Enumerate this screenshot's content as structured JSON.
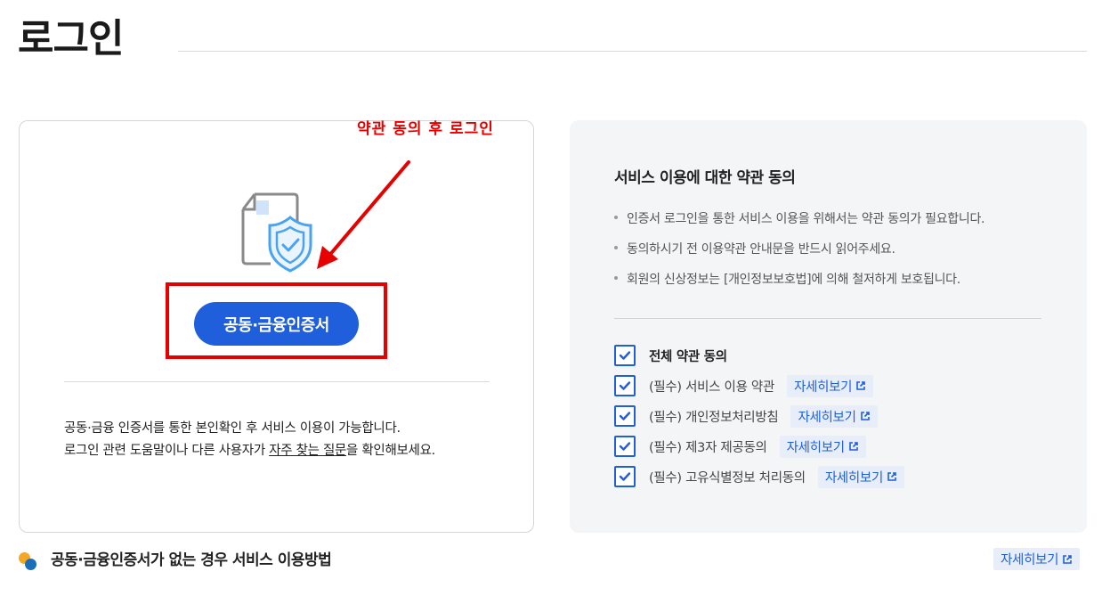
{
  "page": {
    "title": "로그인"
  },
  "annotation": {
    "text": "약관 동의 후 로그인",
    "color": "#e60000"
  },
  "login": {
    "cert_button_label": "공동·금융인증서",
    "help_line_1": "공동·금융 인증서를 통한 본인확인 후 서비스 이용이 가능합니다.",
    "help_line_2_prefix": "로그인 관련 도움말이나 다른 사용자가 ",
    "help_line_2_link": "자주 찾는 질문",
    "help_line_2_suffix": "을 확인해보세요."
  },
  "terms": {
    "heading": "서비스 이용에 대한 약관 동의",
    "notices": [
      "인증서 로그인을 통한 서비스 이용을 위해서는 약관 동의가 필요합니다.",
      "동의하시기 전 이용약관 안내문을 반드시 읽어주세요.",
      "회원의 신상정보는 [개인정보보호법]에 의해 철저하게 보호됩니다."
    ],
    "agree_all": {
      "label": "전체 약관 동의",
      "checked": true
    },
    "items": [
      {
        "label": "(필수) 서비스 이용 약관",
        "checked": true,
        "link": "자세히보기"
      },
      {
        "label": "(필수) 개인정보처리방침",
        "checked": true,
        "link": "자세히보기"
      },
      {
        "label": "(필수) 제3자 제공동의",
        "checked": true,
        "link": "자세히보기"
      },
      {
        "label": "(필수) 고유식별정보 처리동의",
        "checked": true,
        "link": "자세히보기"
      }
    ]
  },
  "bottom": {
    "title": "공동·금융인증서가 없는 경우 서비스 이용방법",
    "detail_link": "자세히보기"
  },
  "icons": {
    "certificate": "certificate-shield-icon",
    "check": "check-icon",
    "external": "external-link-icon",
    "dot": "dots-icon"
  },
  "colors": {
    "accent": "#1f5fdc",
    "annotation": "#e60000",
    "panel_bg": "#f4f5f7",
    "link_bg": "#e8eef9"
  }
}
